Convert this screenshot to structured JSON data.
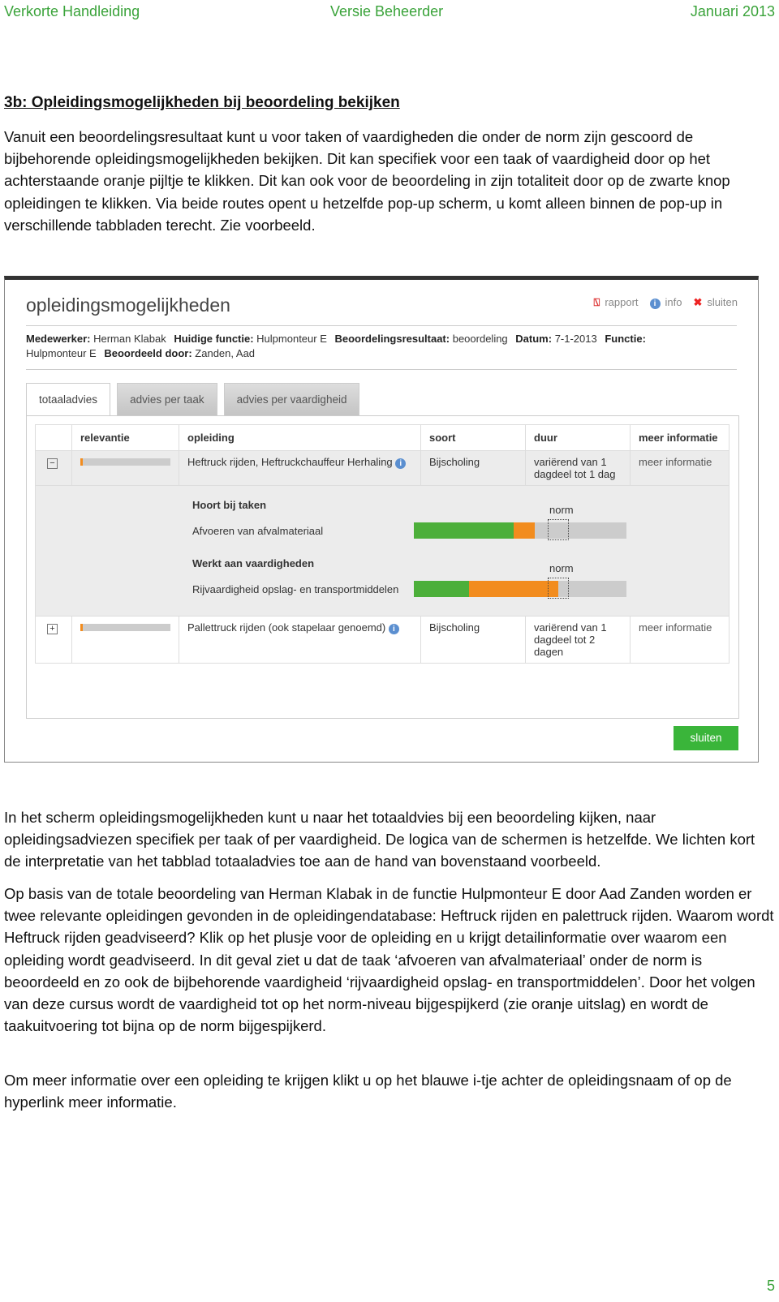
{
  "header": {
    "left": "Verkorte Handleiding",
    "center": "Versie Beheerder",
    "right": "Januari 2013"
  },
  "section_title": "3b: Opleidingsmogelijkheden bij beoordeling bekijken",
  "intro": "Vanuit een beoordelingsresultaat kunt u voor taken of vaardigheden die onder de norm zijn gescoord de bijbehorende opleidingsmogelijkheden bekijken. Dit kan specifiek voor een taak of vaardigheid door op het achterstaande oranje pijltje te klikken. Dit kan ook voor de beoordeling in zijn totaliteit door op de zwarte knop opleidingen te klikken. Via beide routes opent u hetzelfde pop-up scherm, u komt alleen binnen de pop-up in verschillende tabbladen terecht. Zie voorbeeld.",
  "popup": {
    "title": "opleidingsmogelijkheden",
    "actions": [
      {
        "icon": "pdf-icon",
        "label": "rapport"
      },
      {
        "icon": "info-icon",
        "label": "info"
      },
      {
        "icon": "close-x-icon",
        "label": "sluiten"
      }
    ],
    "meta": [
      {
        "k": "Medewerker:",
        "v": "Herman Klabak"
      },
      {
        "k": "Huidige functie:",
        "v": "Hulpmonteur E"
      },
      {
        "k": "Beoordelingsresultaat:",
        "v": "beoordeling"
      },
      {
        "k": "Datum:",
        "v": "7-1-2013"
      },
      {
        "k": "Functie:",
        "v": "Hulpmonteur E"
      },
      {
        "k": "Beoordeeld door:",
        "v": "Zanden, Aad"
      }
    ],
    "tabs": [
      "totaaladvies",
      "advies per taak",
      "advies per vaardigheid"
    ],
    "columns": [
      "relevantie",
      "opleiding",
      "soort",
      "duur",
      "meer informatie"
    ],
    "rows": [
      {
        "toggle": "−",
        "opleiding": "Heftruck rijden, Heftruckchauffeur Herhaling",
        "soort": "Bijscholing",
        "duur": "variërend van 1 dagdeel tot 1 dag",
        "link": "meer informatie"
      },
      {
        "toggle": "+",
        "opleiding": "Pallettruck rijden (ook stapelaar genoemd)",
        "soort": "Bijscholing",
        "duur": "variërend van 1 dagdeel tot 2 dagen",
        "link": "meer informatie"
      }
    ],
    "detail": {
      "tasks_heading": "Hoort bij taken",
      "task": "Afvoeren van afvalmateriaal",
      "skills_heading": "Werkt aan vaardigheden",
      "skill": "Rijvaardigheid opslag- en transportmiddelen",
      "norm_label": "norm",
      "task_bar": {
        "green_pct": 47,
        "orange_end_pct": 57,
        "norm_pct": [
          63,
          73
        ]
      },
      "skill_bar": {
        "green_pct": 26,
        "orange_end_pct": 68,
        "norm_pct": [
          63,
          73
        ]
      },
      "colors": {
        "green": "#4caf3a",
        "orange": "#f28c1e"
      }
    },
    "close_button": "sluiten"
  },
  "para2": "In het scherm opleidingsmogelijkheden kunt u naar het totaaldvies bij een beoordeling kijken, naar opleidingsadviezen specifiek per taak of per vaardigheid. De logica van de schermen is hetzelfde. We lichten kort de interpretatie van het tabblad totaaladvies toe aan de hand van bovenstaand voorbeeld.",
  "para3": "Op basis van de totale beoordeling van Herman Klabak in de functie Hulpmonteur E door Aad Zanden worden er twee relevante opleidingen gevonden in de opleidingendatabase: Heftruck rijden en palettruck rijden. Waarom wordt Heftruck rijden geadviseerd? Klik op het plusje voor de opleiding en u krijgt detailinformatie over waarom een opleiding wordt geadviseerd. In dit geval ziet u dat de taak ‘afvoeren van afvalmateriaal’ onder de norm is beoordeeld en zo ook de bijbehorende vaardigheid ‘rijvaardigheid opslag- en transportmiddelen’. Door het volgen van deze cursus wordt de vaardigheid tot op het norm-niveau bijgespijkerd (zie oranje uitslag) en wordt de taakuitvoering tot bijna op de norm bijgespijkerd.",
  "para4_text": "Om meer informatie over een opleiding te krijgen klikt u op het blauwe i-tje achter de opleidingsnaam of op de hyperlink ",
  "para4_link": "meer informatie",
  "page_number": "5"
}
